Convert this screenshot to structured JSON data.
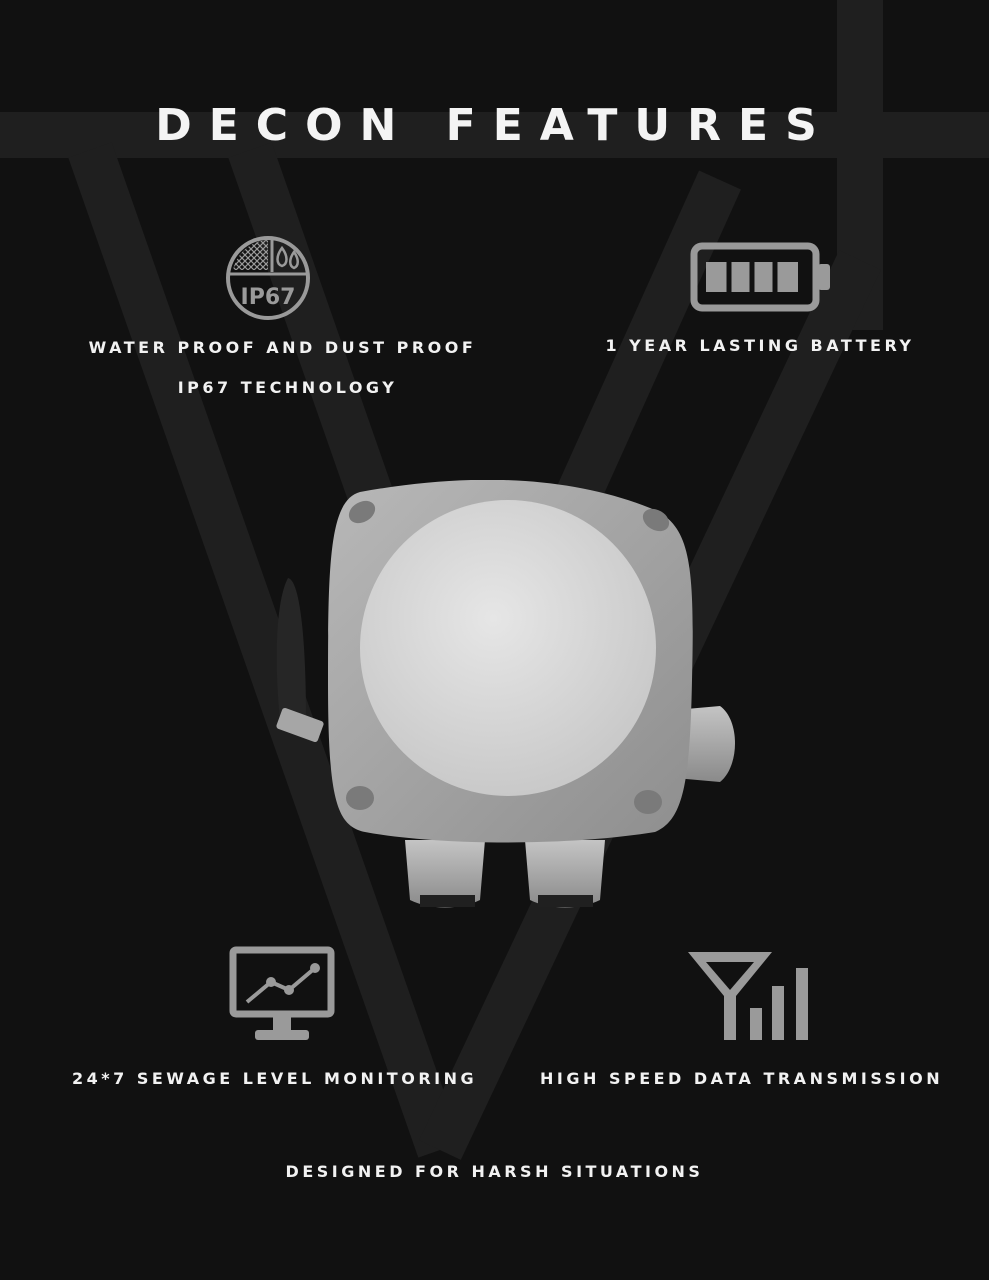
{
  "title": "DECON FEATURES",
  "features": {
    "waterproof_line1": "WATER PROOF AND DUST PROOF",
    "waterproof_line2": "IP67 TECHNOLOGY",
    "ip67_badge": "IP67",
    "battery": "1 YEAR LASTING BATTERY",
    "monitoring": "24*7 SEWAGE LEVEL MONITORING",
    "transmission": "HIGH SPEED DATA TRANSMISSION"
  },
  "footer": "DESIGNED FOR HARSH SITUATIONS",
  "icons": {
    "waterproof": "ip67-shield-icon",
    "battery": "battery-full-icon",
    "monitoring": "monitor-chart-icon",
    "transmission": "signal-tower-icon"
  },
  "colors": {
    "background": "#111111",
    "icon_gray": "#9a9a9a",
    "text": "#f2f2f2"
  }
}
